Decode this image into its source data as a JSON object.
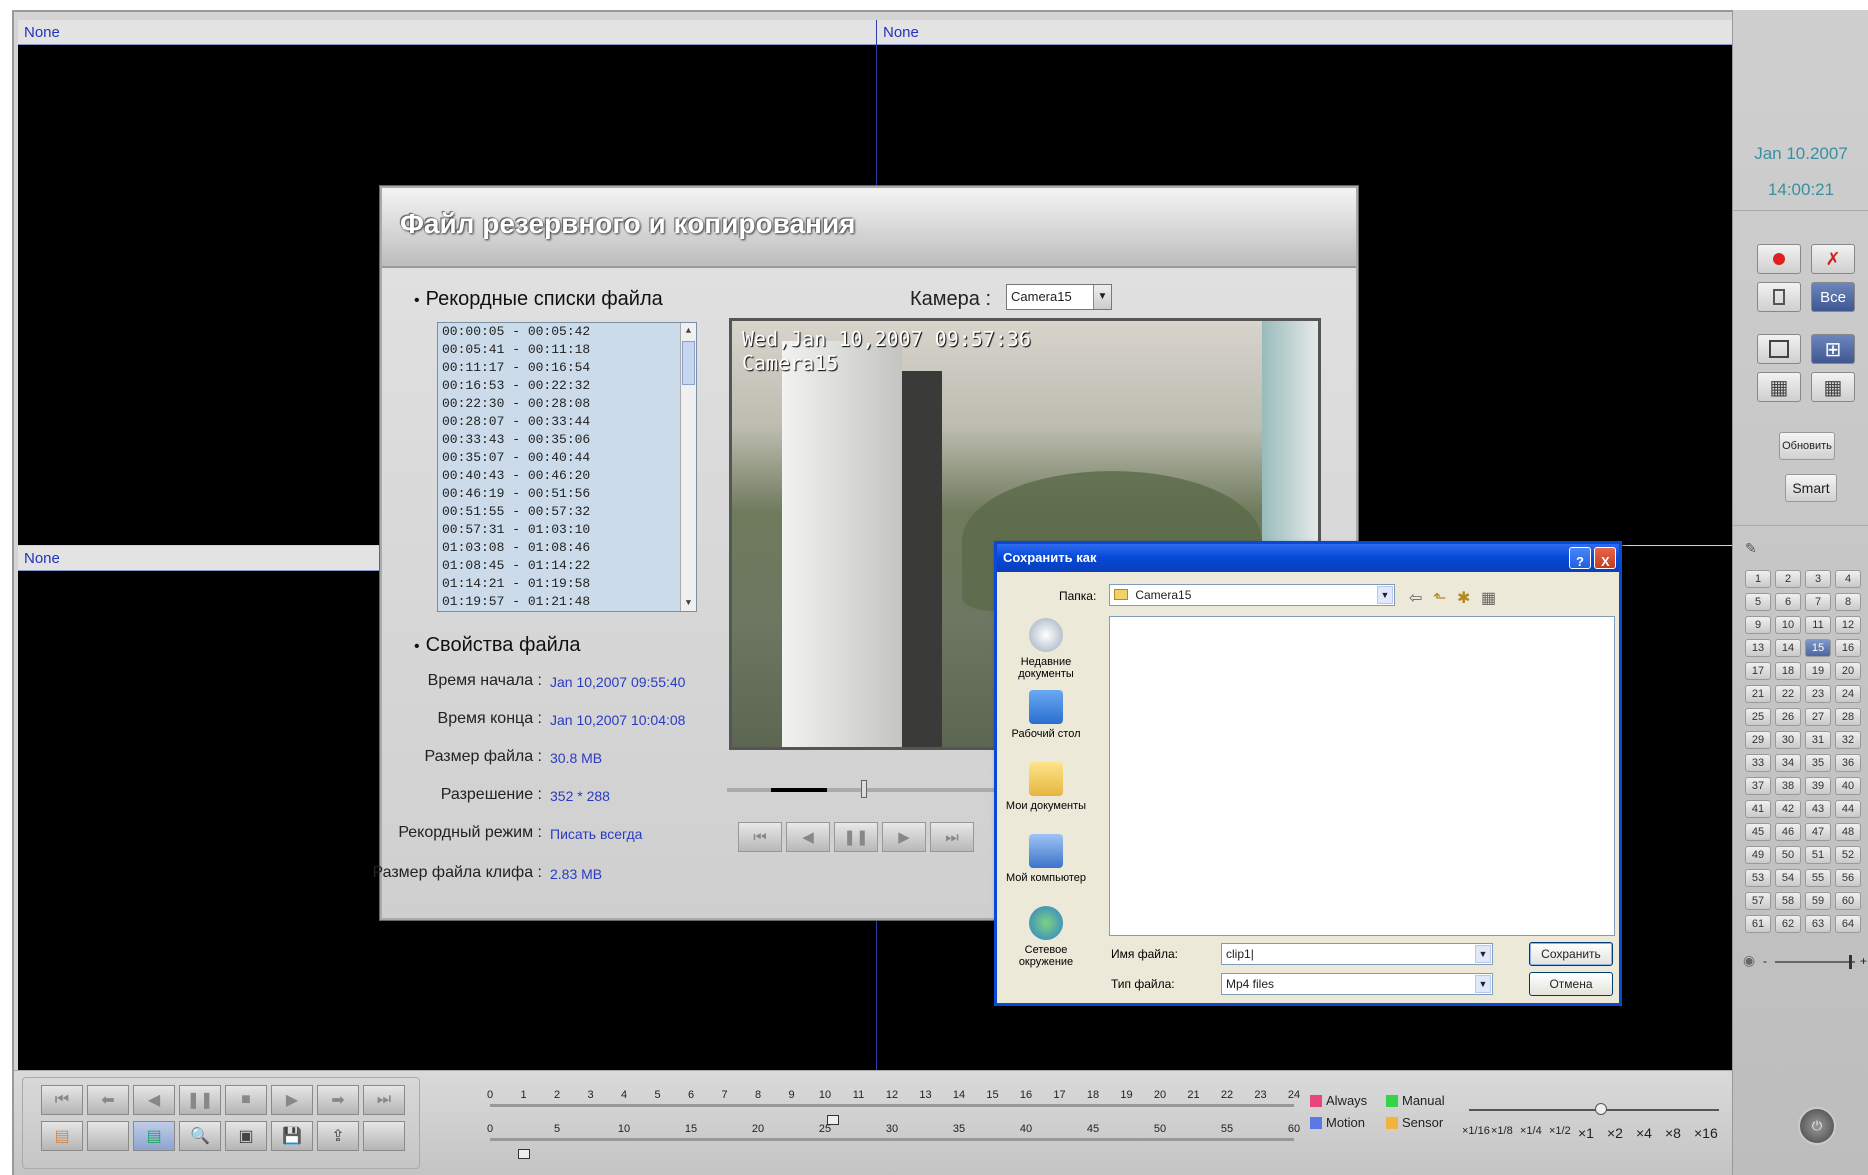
{
  "cameras": {
    "top_left": "None",
    "top_right": "None",
    "bottom_left": "None"
  },
  "clock": {
    "date": "Jan 10.2007",
    "time": "14:00:21"
  },
  "right_panel": {
    "all_label": "Все",
    "refresh_label": "Обновить",
    "smart_label": "Smart",
    "channels": [
      "1",
      "2",
      "3",
      "4",
      "5",
      "6",
      "7",
      "8",
      "9",
      "10",
      "11",
      "12",
      "13",
      "14",
      "15",
      "16",
      "17",
      "18",
      "19",
      "20",
      "21",
      "22",
      "23",
      "24",
      "25",
      "26",
      "27",
      "28",
      "29",
      "30",
      "31",
      "32",
      "33",
      "34",
      "35",
      "36",
      "37",
      "38",
      "39",
      "40",
      "41",
      "42",
      "43",
      "44",
      "45",
      "46",
      "47",
      "48",
      "49",
      "50",
      "51",
      "52",
      "53",
      "54",
      "55",
      "56",
      "57",
      "58",
      "59",
      "60",
      "61",
      "62",
      "63",
      "64"
    ],
    "selected_channel": "15",
    "volume_minus": "-",
    "volume_plus": "+"
  },
  "backup": {
    "title": "Файл резервного и копирования",
    "records_header": "Рекордные списки файла",
    "camera_label": "Камера :",
    "camera_value": "Camera15",
    "records": [
      "00:00:05 - 00:05:42",
      "00:05:41 - 00:11:18",
      "00:11:17 - 00:16:54",
      "00:16:53 - 00:22:32",
      "00:22:30 - 00:28:08",
      "00:28:07 - 00:33:44",
      "00:33:43 - 00:35:06",
      "00:35:07 - 00:40:44",
      "00:40:43 - 00:46:20",
      "00:46:19 - 00:51:56",
      "00:51:55 - 00:57:32",
      "00:57:31 - 01:03:10",
      "01:03:08 - 01:08:46",
      "01:08:45 - 01:14:22",
      "01:14:21 - 01:19:58",
      "01:19:57 - 01:21:48"
    ],
    "props_header": "Свойства файла",
    "props": [
      {
        "label": "Время начала :",
        "value": "Jan 10,2007 09:55:40"
      },
      {
        "label": "Время конца :",
        "value": "Jan 10,2007 10:04:08"
      },
      {
        "label": "Размер файла :",
        "value": "30.8 MB"
      },
      {
        "label": "Разрешение :",
        "value": "352 * 288"
      },
      {
        "label": "Рекордный режим :",
        "value": "Писать всегда"
      },
      {
        "label": "Размер файла клифа :",
        "value": "2.83 MB"
      }
    ],
    "osd_line1": "Wed,Jan 10,2007 09:57:36",
    "osd_line2": "Camera15"
  },
  "saveas": {
    "title": "Сохранить как",
    "folder_label": "Папка:",
    "folder_value": "Camera15",
    "places": [
      "Недавние документы",
      "Рабочий стол",
      "Мои документы",
      "Мой компьютер",
      "Сетевое окружение"
    ],
    "filename_label": "Имя файла:",
    "filename_value": "clip1",
    "filetype_label": "Тип файла:",
    "filetype_value": "Mp4 files",
    "save_label": "Сохранить",
    "cancel_label": "Отмена",
    "help_label": "?",
    "close_label": "X"
  },
  "timeline": {
    "hours": [
      "0",
      "1",
      "2",
      "3",
      "4",
      "5",
      "6",
      "7",
      "8",
      "9",
      "10",
      "11",
      "12",
      "13",
      "14",
      "15",
      "16",
      "17",
      "18",
      "19",
      "20",
      "21",
      "22",
      "23",
      "24"
    ],
    "minutes": [
      "0",
      "5",
      "10",
      "15",
      "20",
      "25",
      "30",
      "35",
      "40",
      "45",
      "50",
      "55",
      "60"
    ]
  },
  "legend": [
    {
      "label": "Always",
      "color": "#e8457a"
    },
    {
      "label": "Manual",
      "color": "#34d34a"
    },
    {
      "label": "Motion",
      "color": "#5a78e6"
    },
    {
      "label": "Sensor",
      "color": "#f2b23c"
    }
  ],
  "speeds": [
    "×1/16",
    "×1/8",
    "×1/4",
    "×1/2",
    "×1",
    "×2",
    "×4",
    "×8",
    "×16"
  ]
}
